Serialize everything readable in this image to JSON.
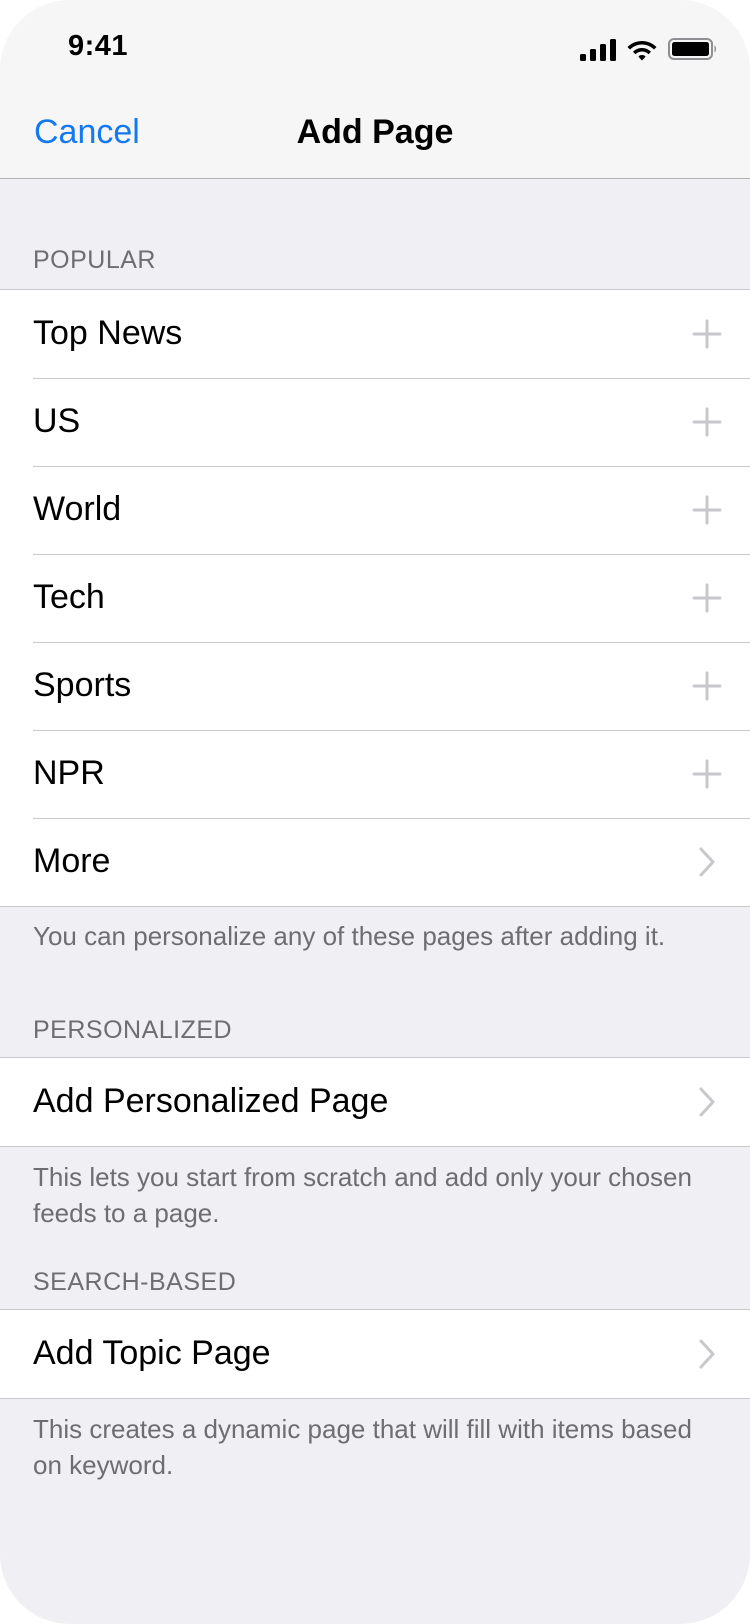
{
  "status_bar": {
    "time": "9:41",
    "icons": [
      "cellular-signal-icon",
      "wifi-icon",
      "battery-icon"
    ]
  },
  "nav": {
    "cancel_label": "Cancel",
    "title": "Add Page"
  },
  "sections": {
    "popular": {
      "header": "POPULAR",
      "items": [
        {
          "label": "Top News",
          "icon": "plus-icon"
        },
        {
          "label": "US",
          "icon": "plus-icon"
        },
        {
          "label": "World",
          "icon": "plus-icon"
        },
        {
          "label": "Tech",
          "icon": "plus-icon"
        },
        {
          "label": "Sports",
          "icon": "plus-icon"
        },
        {
          "label": "NPR",
          "icon": "plus-icon"
        },
        {
          "label": "More",
          "icon": "chevron-right-icon"
        }
      ],
      "footer": "You can personalize any of these pages after adding it."
    },
    "personalized": {
      "header": "PERSONALIZED",
      "items": [
        {
          "label": "Add Personalized Page",
          "icon": "chevron-right-icon"
        }
      ],
      "footer": "This lets you start from scratch and add only your chosen feeds to a page."
    },
    "search_based": {
      "header": "SEARCH-BASED",
      "items": [
        {
          "label": "Add Topic Page",
          "icon": "chevron-right-icon"
        }
      ],
      "footer": "This creates a dynamic page that will fill with items based on keyword."
    }
  },
  "colors": {
    "accent": "#1479f0",
    "background": "#efeff4",
    "header_background": "#f6f6f7",
    "secondary_text": "#6d6d72",
    "icon_gray": "#c7c7cc"
  }
}
